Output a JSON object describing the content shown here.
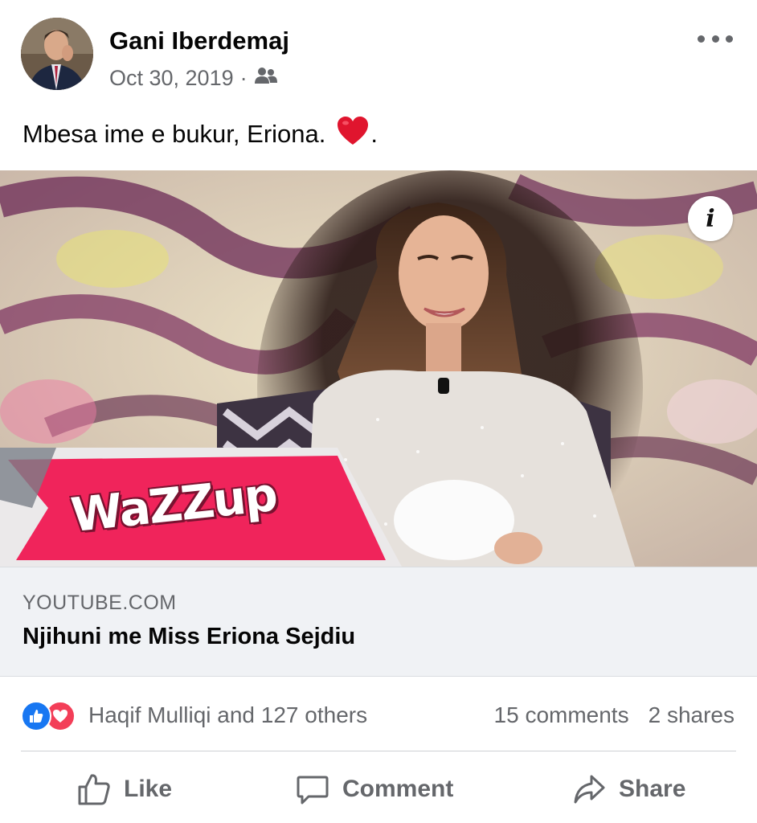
{
  "post": {
    "author": "Gani Iberdemaj",
    "date": "Oct 30, 2019",
    "separator": "·",
    "audience_icon": "friends-icon",
    "more_icon": "more-options-icon",
    "caption_text": "Mbesa ime e bukur, Eriona.",
    "caption_emoji": "❤️",
    "caption_end": "."
  },
  "link": {
    "domain": "YOUTUBE.COM",
    "title": "Njihuni me Miss Eriona Sejdiu",
    "thumbnail_logo_text": "WaZZup",
    "info_label": "i"
  },
  "stats": {
    "reaction_icons": [
      "like-reaction-icon",
      "love-reaction-icon"
    ],
    "reactors": "Haqif Mulliqi and 127 others",
    "comments": "15 comments",
    "shares": "2 shares"
  },
  "actions": {
    "like": "Like",
    "comment": "Comment",
    "share": "Share"
  },
  "colors": {
    "secondary_text": "#65676b",
    "like_blue": "#1877f2",
    "love_red": "#f33e58",
    "link_bg": "#f0f2f5",
    "banner_pink": "#f0245b"
  }
}
